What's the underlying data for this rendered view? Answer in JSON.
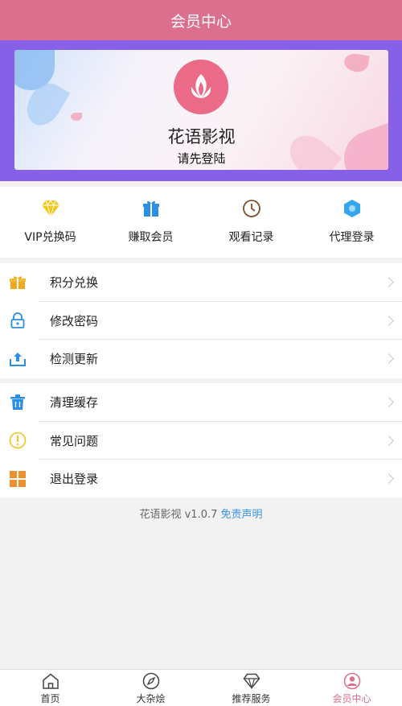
{
  "header": {
    "title": "会员中心"
  },
  "banner": {
    "app_name": "花语影视",
    "login_hint": "请先登陆"
  },
  "quick_actions": [
    {
      "label": "VIP兑换码",
      "icon": "diamond-icon",
      "color": "#f5c518"
    },
    {
      "label": "赚取会员",
      "icon": "gift-icon",
      "color": "#2b8fe8"
    },
    {
      "label": "观看记录",
      "icon": "clock-icon",
      "color": "#7a5230"
    },
    {
      "label": "代理登录",
      "icon": "hexagon-icon",
      "color": "#35a6ee"
    }
  ],
  "menu_group1": [
    {
      "label": "积分兑换",
      "icon": "gift-icon"
    },
    {
      "label": "修改密码",
      "icon": "lock-icon"
    },
    {
      "label": "检测更新",
      "icon": "upload-icon"
    }
  ],
  "menu_group2": [
    {
      "label": "清理缓存",
      "icon": "trash-icon"
    },
    {
      "label": "常见问题",
      "icon": "info-icon"
    },
    {
      "label": "退出登录",
      "icon": "grid-icon"
    }
  ],
  "footer": {
    "version": "花语影视 v1.0.7",
    "disclaimer": "免责声明"
  },
  "tabs": [
    {
      "label": "首页",
      "icon": "home-icon",
      "active": false
    },
    {
      "label": "大杂烩",
      "icon": "compass-icon",
      "active": false
    },
    {
      "label": "推荐服务",
      "icon": "diamond-icon",
      "active": false
    },
    {
      "label": "会员中心",
      "icon": "user-icon",
      "active": true
    }
  ],
  "colors": {
    "header": "#dd6f8e",
    "banner_bg": "#8660e6",
    "accent_link": "#3a95e8",
    "active_tab": "#dd6f8e"
  }
}
